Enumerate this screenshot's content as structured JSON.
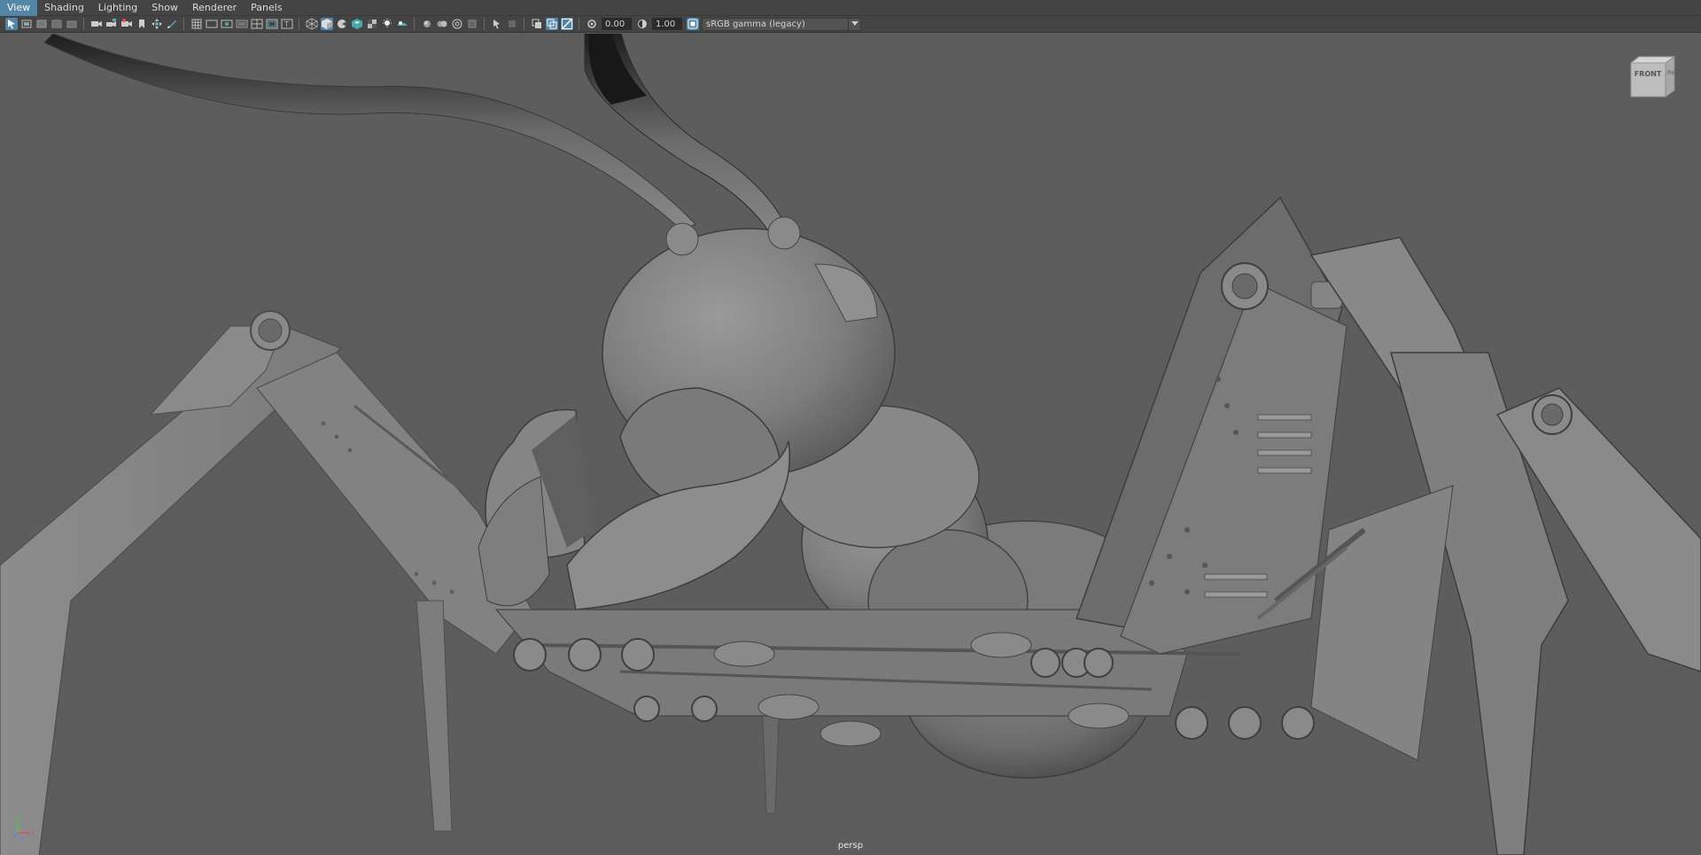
{
  "menubar": {
    "items": [
      {
        "label": "View",
        "active": true
      },
      {
        "label": "Shading",
        "active": false
      },
      {
        "label": "Lighting",
        "active": false
      },
      {
        "label": "Show",
        "active": false
      },
      {
        "label": "Renderer",
        "active": false
      },
      {
        "label": "Panels",
        "active": false
      }
    ]
  },
  "toolbar": {
    "exposure_value": "0.00",
    "gamma_value": "1.00",
    "color_space": "sRGB gamma (legacy)",
    "icons": [
      "select-camera-icon",
      "camera-attributes-icon",
      "bookmarks-icon",
      "image-plane-icon",
      "grease-pencil-icon",
      "camera-icon",
      "lock-camera-icon",
      "snapshot-icon",
      "bookmark-icon",
      "2d-pan-zoom-icon",
      "grease-pencil-tool-icon",
      "grid-icon",
      "film-gate-icon",
      "resolution-gate-icon",
      "gate-mask-icon",
      "field-chart-icon",
      "safe-action-icon",
      "safe-title-icon",
      "wireframe-icon",
      "smooth-shade-icon",
      "default-material-icon",
      "textured-icon",
      "use-all-lights-icon",
      "shadows-icon",
      "screen-space-ao-icon",
      "motion-blur-icon",
      "multisample-aa-icon",
      "depth-of-field-icon",
      "xray-icon",
      "xray-active-components-icon",
      "xray-joints-icon",
      "isolate-select-icon",
      "backface-culling-icon",
      "shaded-wireframe-icon"
    ]
  },
  "viewport": {
    "camera_name": "persp",
    "viewcube_face": "FRONT",
    "viewcube_side": "RIG",
    "axes": {
      "x": "x",
      "y": "y",
      "z": "z"
    },
    "colors": {
      "background": "#5d5d5d",
      "menubar": "#444444",
      "accent": "#5285a6"
    }
  }
}
